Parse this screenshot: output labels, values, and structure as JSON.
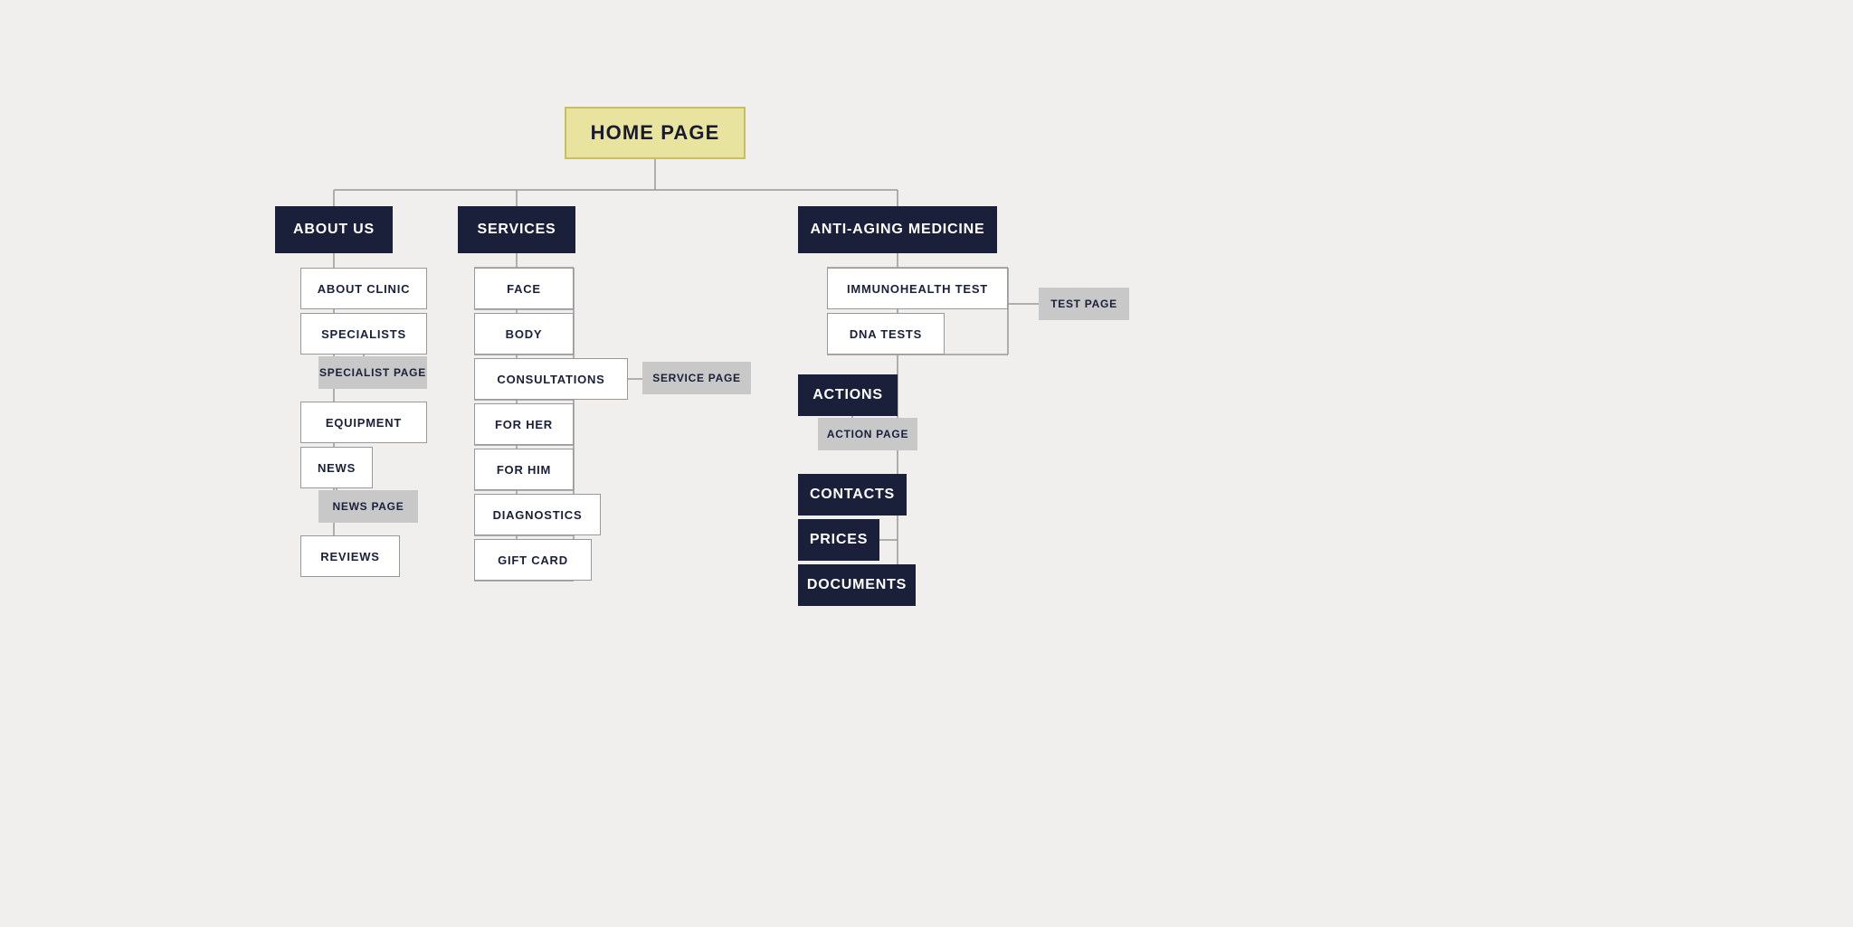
{
  "nodes": {
    "home": "HOME PAGE",
    "about_us": "ABOUT US",
    "about_clinic": "ABOUT CLINIC",
    "specialists": "SPECIALISTS",
    "specialist_page": "SPECIALIST PAGE",
    "equipment": "EQUIPMENT",
    "news": "NEWS",
    "news_page": "NEWS PAGE",
    "reviews": "REVIEWS",
    "services": "SERVICES",
    "face": "FACE",
    "body": "BODY",
    "consultations": "CONSULTATIONS",
    "service_page": "SERVICE PAGE",
    "for_her": "FOR HER",
    "for_him": "FOR HIM",
    "diagnostics": "DIAGNOSTICS",
    "gift_card": "GIFT CARD",
    "anti_aging": "ANTI-AGING MEDICINE",
    "immunohealth": "IMMUNOHEALTH TEST",
    "dna_tests": "DNA TESTS",
    "test_page": "TEST PAGE",
    "actions": "ACTIONS",
    "action_page": "ACTION PAGE",
    "contacts": "CONTACTS",
    "prices": "PRICES",
    "documents": "DOCUMENTS"
  }
}
